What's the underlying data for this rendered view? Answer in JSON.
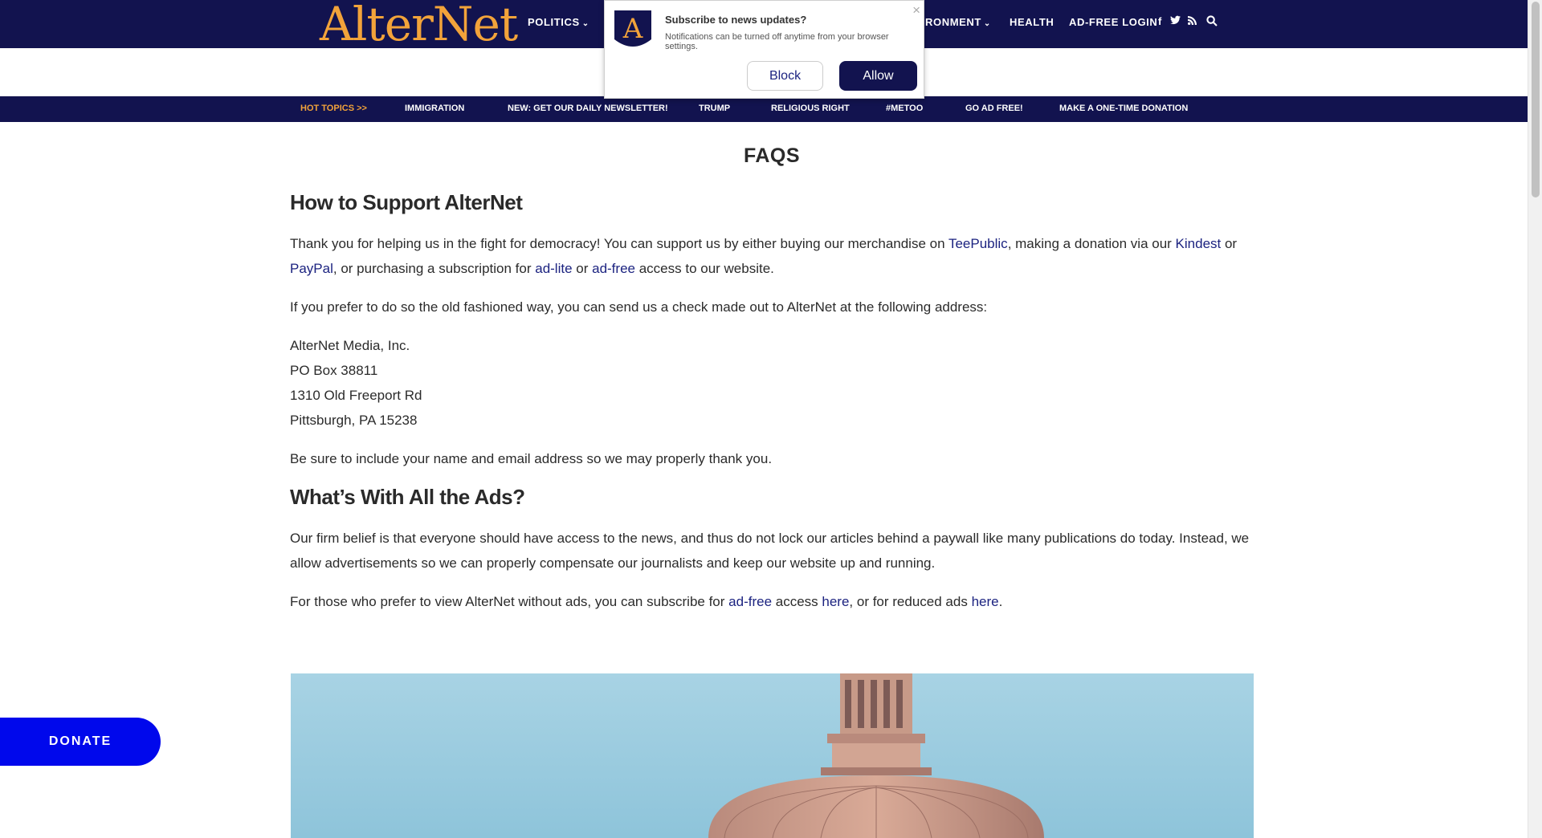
{
  "header": {
    "logo": "AlterNet",
    "nav": [
      "POLITICS",
      "RONMENT",
      "HEALTH",
      "AD-FREE LOGIN"
    ],
    "social_icons": [
      "facebook-icon",
      "twitter-icon",
      "rss-icon",
      "search-icon"
    ],
    "social_glyphs": {
      "facebook": "f",
      "twitter": "🐦",
      "rss": "◠",
      "search": "🔍"
    }
  },
  "topics": {
    "hot": "HOT TOPICS >>",
    "items": [
      "IMMIGRATION",
      "NEW: GET OUR DAILY NEWSLETTER!",
      "TRUMP",
      "RELIGIOUS RIGHT",
      "#METOO",
      "GO AD FREE!",
      "MAKE A ONE-TIME DONATION"
    ]
  },
  "popup": {
    "title": "Subscribe to news updates?",
    "body": "Notifications can be turned off anytime from your browser settings.",
    "block": "Block",
    "allow": "Allow",
    "close": "×",
    "icon_letter": "A"
  },
  "page": {
    "title": "FAQS",
    "section1": {
      "heading": "How to Support AlterNet",
      "p1_a": "Thank you for helping us in the fight for democracy! You can support us by either buying our merchandise on ",
      "link_teepublic": "TeePublic",
      "p1_b": ", making a donation via our ",
      "link_kindest": "Kindest",
      "p1_c": " or ",
      "link_paypal": "PayPal",
      "p1_d": ", or purchasing a subscription for ",
      "link_adlite": "ad-lite",
      "p1_e": " or ",
      "link_adfree": "ad-free",
      "p1_f": " access to our website.",
      "p2": "If you prefer to do so the old fashioned way, you can send us a check made out to AlterNet at the following address:",
      "address": [
        "AlterNet Media, Inc.",
        "PO Box 38811",
        "1310 Old Freeport Rd",
        "Pittsburgh, PA 15238"
      ],
      "p3": "Be sure to include your name and email address so we may properly thank you."
    },
    "section2": {
      "heading": "What’s With All the Ads?",
      "p1": "Our firm belief is that everyone should have access to the news, and thus do not lock our articles behind a paywall like many publications do today. Instead, we allow advertisements so we can properly compensate our journalists and keep our website up and running.",
      "p2_a": "For those who prefer to view AlterNet without ads, you can subscribe for ",
      "link_adfree": "ad-free",
      "p2_b": " access ",
      "link_here1": "here",
      "p2_c": ", or for reduced ads ",
      "link_here2": "here",
      "p2_d": "."
    }
  },
  "donate": "DONATE"
}
